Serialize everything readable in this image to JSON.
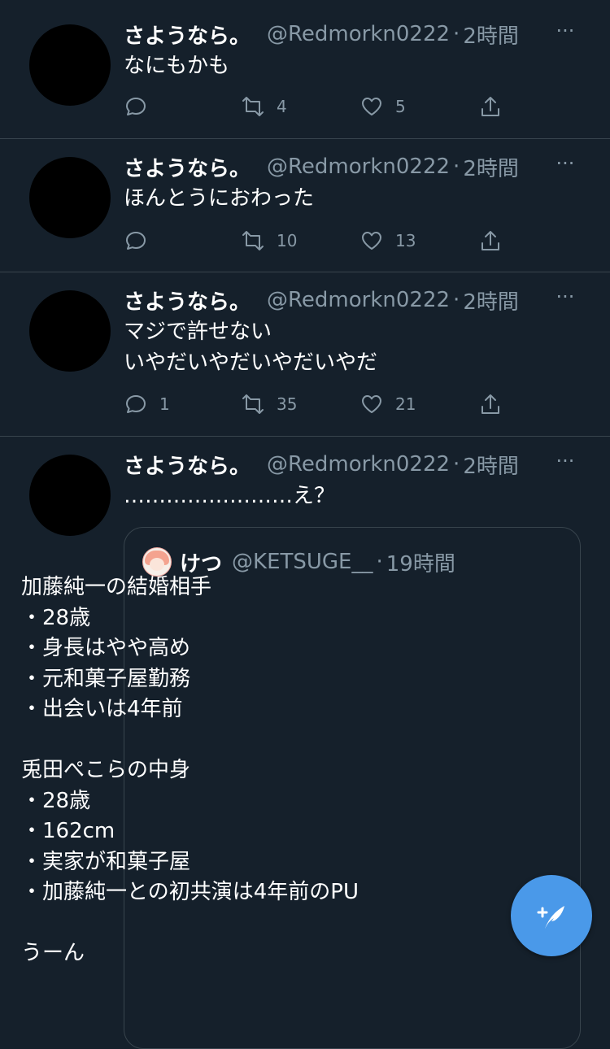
{
  "tweets": [
    {
      "name": "さようなら。",
      "handle": "@Redmorkn0222",
      "dot": "·",
      "time": "2時間",
      "text": "なにもかも",
      "reply_count": "",
      "retweet_count": "4",
      "like_count": "5"
    },
    {
      "name": "さようなら。",
      "handle": "@Redmorkn0222",
      "dot": "·",
      "time": "2時間",
      "text": "ほんとうにおわった",
      "reply_count": "",
      "retweet_count": "10",
      "like_count": "13"
    },
    {
      "name": "さようなら。",
      "handle": "@Redmorkn0222",
      "dot": "·",
      "time": "2時間",
      "text": "マジで許せない\nいやだいやだいやだいやだ",
      "reply_count": "1",
      "retweet_count": "35",
      "like_count": "21"
    },
    {
      "name": "さようなら。",
      "handle": "@Redmorkn0222",
      "dot": "·",
      "time": "2時間",
      "text": "……………………え？"
    }
  ],
  "more_label": "···",
  "quote": {
    "name": "けつ",
    "handle": "@KETSUGE__",
    "dot": "·",
    "time": "19時間",
    "text": "加藤純一の結婚相手\n・28歳\n・身長はやや高め\n・元和菓子屋勤務\n・出会いは4年前\n\n兎田ぺこらの中身\n・28歳\n・162cm\n・実家が和菓子屋\n・加藤純一との初共演は4年前のPU\n\nうーん"
  },
  "icons": {
    "reply": "reply-icon",
    "retweet": "retweet-icon",
    "like": "heart-icon",
    "share": "share-icon",
    "more": "more-icon",
    "compose": "compose-icon"
  },
  "colors": {
    "background": "#15202b",
    "secondary_text": "#8899a6",
    "divider": "#38444d",
    "accent": "#4a99e9"
  }
}
